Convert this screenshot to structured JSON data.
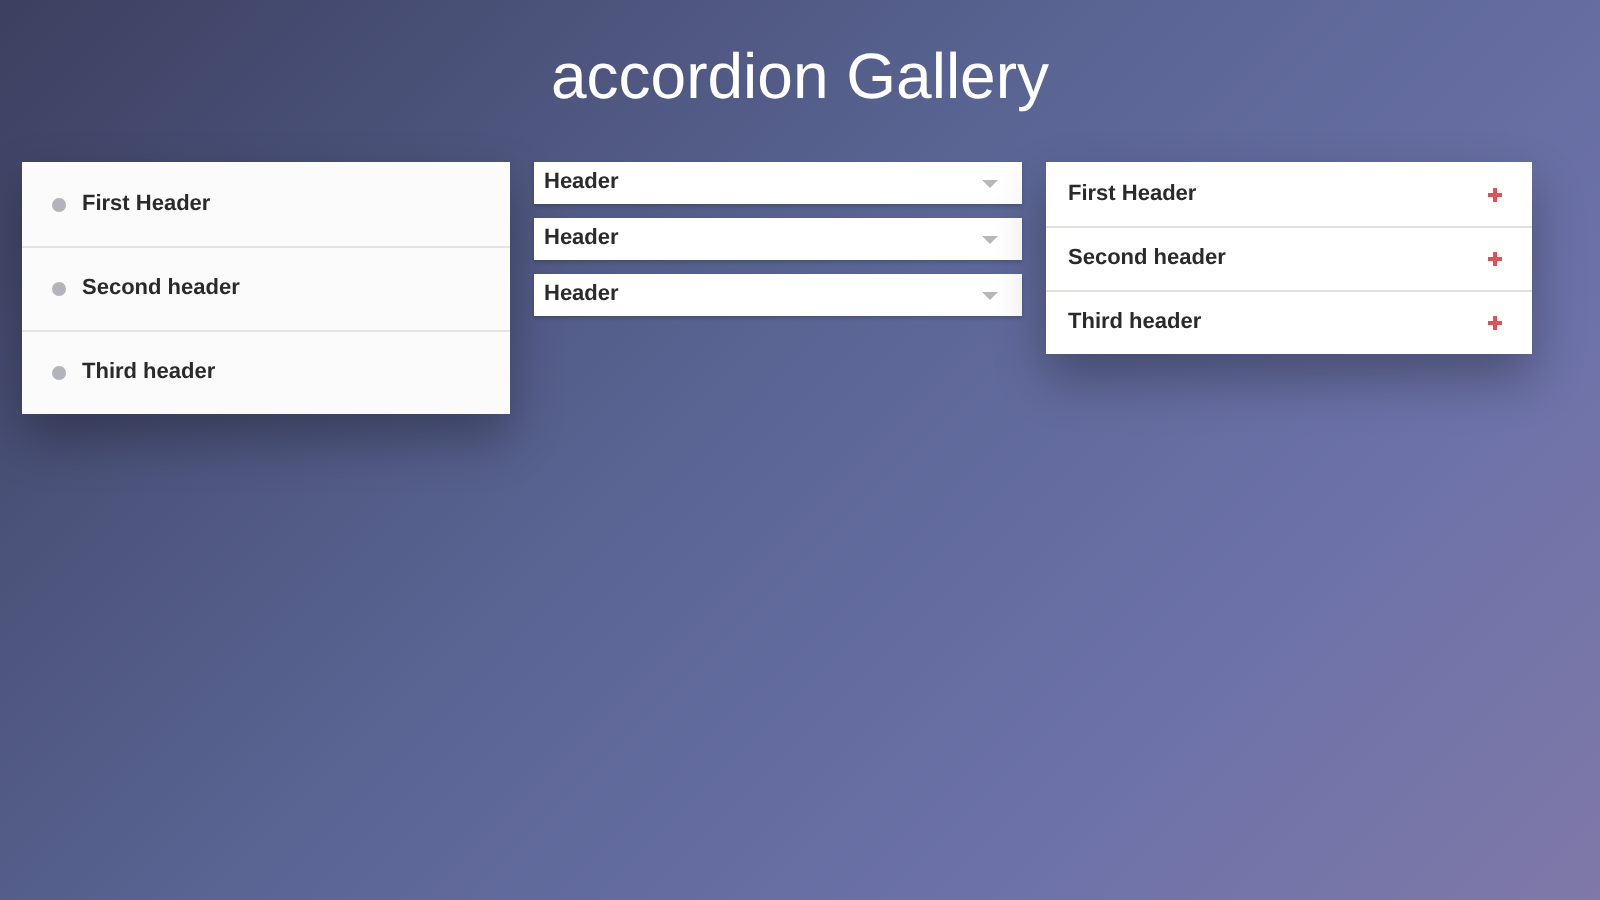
{
  "title": "accordion Gallery",
  "accordion_dots": [
    {
      "header": "First Header",
      "expanded": false
    },
    {
      "header": "Second header",
      "expanded": false
    },
    {
      "header": "Third header",
      "expanded": false
    }
  ],
  "accordion_caret": [
    {
      "header": "Header",
      "expanded": false
    },
    {
      "header": "Header",
      "expanded": false
    },
    {
      "header": "Header",
      "expanded": false
    }
  ],
  "accordion_plus": [
    {
      "header": "First Header",
      "expanded": false
    },
    {
      "header": "Second header",
      "expanded": false
    },
    {
      "header": "Third header",
      "expanded": false
    }
  ]
}
